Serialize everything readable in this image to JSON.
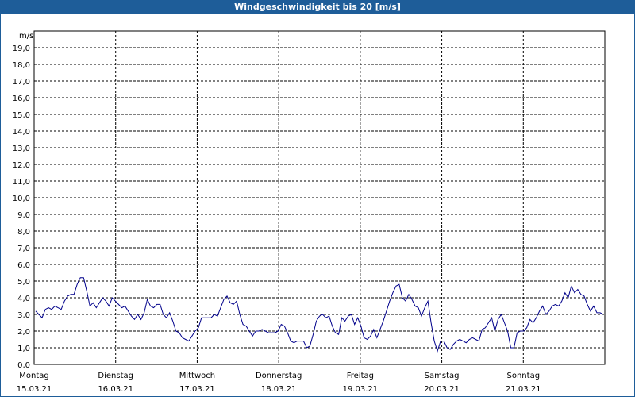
{
  "window": {
    "title": "Windgeschwindigkeit bis 20 [m/s]"
  },
  "colors": {
    "titlebar": "#1e5d99",
    "line": "#00008b",
    "grid": "#000000"
  },
  "chart_data": {
    "type": "line",
    "title": "Windgeschwindigkeit bis 20 [m/s]",
    "ylabel": "m/s",
    "ylim": [
      0,
      20
    ],
    "yticks": [
      "0,0",
      "1,0",
      "2,0",
      "3,0",
      "4,0",
      "5,0",
      "6,0",
      "7,0",
      "8,0",
      "9,0",
      "10,0",
      "11,0",
      "12,0",
      "13,0",
      "14,0",
      "15,0",
      "16,0",
      "17,0",
      "18,0",
      "19,0"
    ],
    "x_categories": [
      {
        "day": "Montag",
        "date": "15.03.21"
      },
      {
        "day": "Dienstag",
        "date": "16.03.21"
      },
      {
        "day": "Mittwoch",
        "date": "17.03.21"
      },
      {
        "day": "Donnerstag",
        "date": "18.03.21"
      },
      {
        "day": "Freitag",
        "date": "19.03.21"
      },
      {
        "day": "Samstag",
        "date": "20.03.21"
      },
      {
        "day": "Sonntag",
        "date": "21.03.21"
      }
    ],
    "grid": true,
    "series": [
      {
        "values": [
          3.2,
          3.0,
          2.8,
          3.3,
          3.4,
          3.3,
          3.5,
          3.4,
          3.3,
          3.8,
          4.1,
          4.2,
          4.2,
          4.8,
          5.2,
          5.2,
          4.4,
          3.5,
          3.7,
          3.4,
          3.7,
          4.0,
          3.8,
          3.5,
          4.0,
          3.8,
          3.6,
          3.4,
          3.5,
          3.2,
          2.9,
          2.7,
          3.0,
          2.7,
          3.1,
          3.9,
          3.5,
          3.4,
          3.6,
          3.6,
          3.0,
          2.8,
          3.1,
          2.6,
          2.0,
          1.9,
          1.6,
          1.5,
          1.4,
          1.7,
          2.0,
          2.2,
          2.8,
          2.8,
          2.8,
          2.8,
          3.0,
          2.9,
          3.4,
          3.9,
          4.1,
          3.7,
          3.6,
          3.8,
          3.0,
          2.4,
          2.3,
          2.0,
          1.7,
          2.0,
          2.0,
          2.1,
          2.0,
          1.9,
          1.9,
          1.9,
          2.0,
          2.4,
          2.3,
          1.9,
          1.4,
          1.3,
          1.4,
          1.4,
          1.4,
          1.0,
          1.1,
          1.8,
          2.6,
          2.9,
          3.0,
          2.8,
          2.9,
          2.3,
          1.9,
          1.8,
          2.8,
          2.6,
          2.9,
          3.0,
          2.4,
          2.8,
          2.3,
          1.6,
          1.5,
          1.7,
          2.1,
          1.6,
          2.1,
          2.6,
          3.2,
          3.8,
          4.3,
          4.7,
          4.8,
          4.0,
          3.8,
          4.2,
          3.9,
          3.5,
          3.4,
          2.9,
          3.4,
          3.8,
          2.5,
          1.4,
          0.8,
          1.4,
          1.4,
          1.0,
          0.9,
          1.2,
          1.4,
          1.5,
          1.4,
          1.3,
          1.5,
          1.6,
          1.5,
          1.4,
          2.1,
          2.2,
          2.5,
          2.8,
          2.0,
          2.7,
          3.0,
          2.5,
          2.0,
          1.0,
          1.0,
          1.9,
          2.0,
          2.0,
          2.2,
          2.7,
          2.5,
          2.8,
          3.2,
          3.5,
          3.0,
          3.2,
          3.5,
          3.6,
          3.5,
          3.8,
          4.3,
          4.0,
          4.7,
          4.3,
          4.5,
          4.2,
          4.1,
          3.6,
          3.2,
          3.5,
          3.1,
          3.1,
          3.0
        ]
      }
    ]
  }
}
